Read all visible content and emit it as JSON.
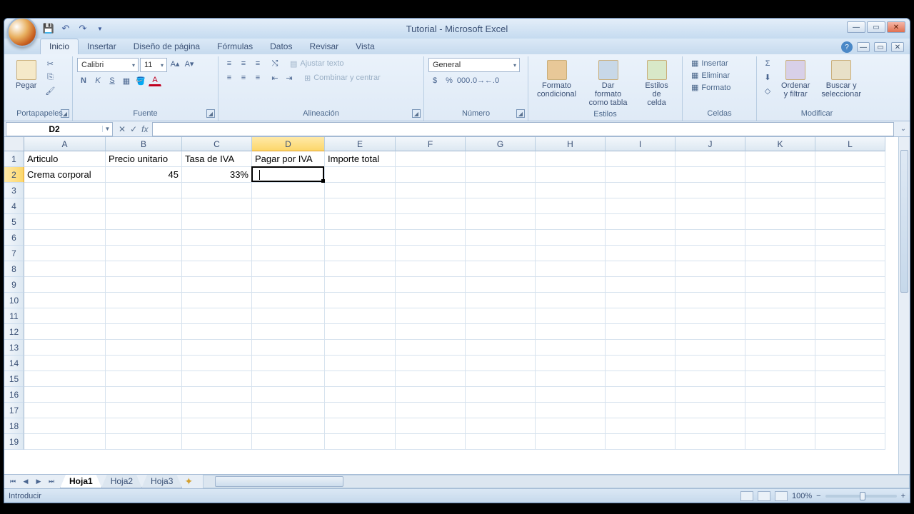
{
  "titlebar": {
    "title": "Tutorial - Microsoft Excel"
  },
  "tabs": {
    "items": [
      "Inicio",
      "Insertar",
      "Diseño de página",
      "Fórmulas",
      "Datos",
      "Revisar",
      "Vista"
    ],
    "active": 0
  },
  "ribbon": {
    "clipboard": {
      "paste": "Pegar",
      "label": "Portapapeles"
    },
    "font": {
      "name": "Calibri",
      "size": "11",
      "label": "Fuente"
    },
    "alignment": {
      "wrap": "Ajustar texto",
      "merge": "Combinar y centrar",
      "label": "Alineación"
    },
    "number": {
      "format": "General",
      "label": "Número"
    },
    "styles": {
      "cond": "Formato\ncondicional",
      "table": "Dar formato\ncomo tabla",
      "cell": "Estilos de\ncelda",
      "label": "Estilos"
    },
    "cells": {
      "insert": "Insertar",
      "delete": "Eliminar",
      "format": "Formato",
      "label": "Celdas"
    },
    "editing": {
      "sort": "Ordenar\ny filtrar",
      "find": "Buscar y\nseleccionar",
      "label": "Modificar"
    }
  },
  "namebox": {
    "ref": "D2"
  },
  "columns": [
    "A",
    "B",
    "C",
    "D",
    "E",
    "F",
    "G",
    "H",
    "I",
    "J",
    "K",
    "L"
  ],
  "active_col_idx": 3,
  "active_row_idx": 1,
  "row_count": 19,
  "cells": {
    "headers": [
      "Articulo",
      "Precio unitario",
      "Tasa de IVA",
      "Pagar por IVA",
      "Importe total"
    ],
    "row2": {
      "A": "Crema corporal",
      "B": "45",
      "C": "33%"
    }
  },
  "sheets": {
    "items": [
      "Hoja1",
      "Hoja2",
      "Hoja3"
    ],
    "active": 0
  },
  "status": {
    "mode": "Introducir",
    "zoom": "100%"
  }
}
